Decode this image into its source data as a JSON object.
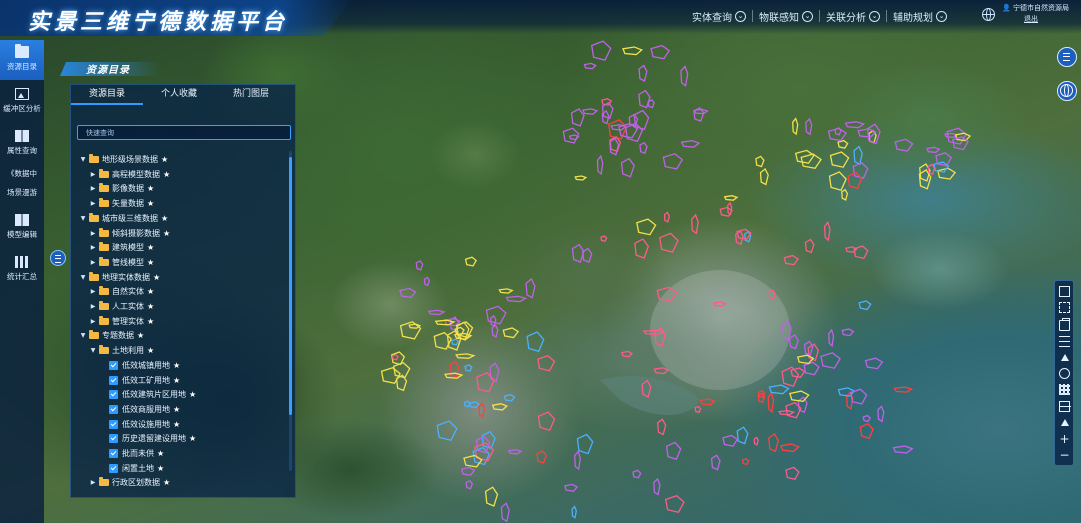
{
  "header": {
    "title": "实景三维宁德数据平台",
    "nav": [
      {
        "label": "实体查询"
      },
      {
        "label": "物联感知"
      },
      {
        "label": "关联分析"
      },
      {
        "label": "辅助规划"
      }
    ],
    "org": "宁德市自然资源局",
    "logout": "退出"
  },
  "sidebar": {
    "items": [
      {
        "label": "资源目录",
        "icon": "folder-icon",
        "active": true
      },
      {
        "label": "缓冲区分析",
        "icon": "image-icon",
        "active": false
      },
      {
        "label": "属性查询",
        "icon": "book-icon",
        "active": false
      },
      {
        "label": "场景漫游",
        "icon": "book-icon",
        "active": false
      },
      {
        "label": "模型编辑",
        "icon": "book-icon",
        "active": false
      },
      {
        "label": "统计汇总",
        "icon": "bars-icon",
        "active": false
      }
    ],
    "tooltip": "《数据中"
  },
  "panel": {
    "heading": "资源目录",
    "tabs": [
      {
        "label": "资源目录",
        "active": true
      },
      {
        "label": "个人收藏",
        "active": false
      },
      {
        "label": "热门图层",
        "active": false
      }
    ],
    "search_placeholder": "快速查询",
    "star": "★",
    "tree": [
      {
        "label": "地形级场景数据",
        "level": 0,
        "type": "folder",
        "expanded": true
      },
      {
        "label": "高程模型数据",
        "level": 1,
        "type": "folder",
        "expanded": false
      },
      {
        "label": "影像数据",
        "level": 1,
        "type": "folder",
        "expanded": false
      },
      {
        "label": "矢量数据",
        "level": 1,
        "type": "folder",
        "expanded": false
      },
      {
        "label": "城市级三维数据",
        "level": 0,
        "type": "folder",
        "expanded": true
      },
      {
        "label": "倾斜摄影数据",
        "level": 1,
        "type": "folder",
        "expanded": false
      },
      {
        "label": "建筑模型",
        "level": 1,
        "type": "folder",
        "expanded": false
      },
      {
        "label": "管线模型",
        "level": 1,
        "type": "folder",
        "expanded": false
      },
      {
        "label": "地理实体数据",
        "level": 0,
        "type": "folder",
        "expanded": true
      },
      {
        "label": "自然实体",
        "level": 1,
        "type": "folder",
        "expanded": false
      },
      {
        "label": "人工实体",
        "level": 1,
        "type": "folder",
        "expanded": false
      },
      {
        "label": "管理实体",
        "level": 1,
        "type": "folder",
        "expanded": false
      },
      {
        "label": "专题数据",
        "level": 0,
        "type": "folder",
        "expanded": true
      },
      {
        "label": "土地利用",
        "level": 1,
        "type": "folder",
        "expanded": true
      },
      {
        "label": "低效城镇用地",
        "level": 2,
        "type": "check"
      },
      {
        "label": "低效工矿用地",
        "level": 2,
        "type": "check"
      },
      {
        "label": "低效建筑片区用地",
        "level": 2,
        "type": "check"
      },
      {
        "label": "低效商服用地",
        "level": 2,
        "type": "check"
      },
      {
        "label": "低效设施用地",
        "level": 2,
        "type": "check"
      },
      {
        "label": "历史遗留建设用地",
        "level": 2,
        "type": "check"
      },
      {
        "label": "批而未供",
        "level": 2,
        "type": "check"
      },
      {
        "label": "闲置土地",
        "level": 2,
        "type": "check"
      },
      {
        "label": "行政区划数据",
        "level": 1,
        "type": "folder",
        "expanded": false
      }
    ]
  },
  "right_buttons": [
    {
      "icon": "list-icon"
    },
    {
      "icon": "globe-icon"
    }
  ],
  "toolbar": [
    {
      "icon": "print-icon"
    },
    {
      "icon": "fullscreen-icon"
    },
    {
      "icon": "lock-icon"
    },
    {
      "icon": "layers-icon"
    },
    {
      "icon": "north-arrow-icon"
    },
    {
      "icon": "globe-icon"
    },
    {
      "icon": "grid-icon"
    },
    {
      "icon": "list-icon"
    },
    {
      "icon": "terrain-icon"
    },
    {
      "icon": "zoom-in-icon",
      "glyph": "+"
    },
    {
      "icon": "zoom-out-icon",
      "glyph": "−"
    }
  ],
  "colors": {
    "accent": "#2f9bff",
    "panel_bg": "#08224a",
    "folder": "#f4b942",
    "parcel_purple": "#c061e8",
    "parcel_pink": "#ff5a8a",
    "parcel_yellow": "#f2e04b",
    "parcel_blue": "#4ab0ff",
    "parcel_red": "#ff4040"
  }
}
